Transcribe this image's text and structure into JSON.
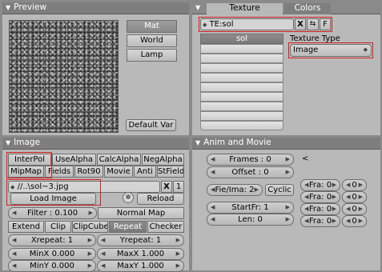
{
  "preview": {
    "title": "Preview",
    "buttons": [
      "Mat",
      "World",
      "Lamp"
    ],
    "default_var": "Default Var"
  },
  "texture": {
    "tabs": [
      "Texture",
      "Colors"
    ],
    "name_field": "TE:sol",
    "x_btn": "X",
    "f_btn": "F",
    "list_header": "sol",
    "type_label": "Texture Type",
    "type_value": "Image"
  },
  "image": {
    "title": "Image",
    "row1": [
      "InterPol",
      "UseAlpha",
      "CalcAlpha",
      "NegAlpha"
    ],
    "row2": [
      "MipMap",
      "Fields",
      "Rot90",
      "Movie",
      "Anti",
      "StField"
    ],
    "path": "//..\\sol~3.jpg",
    "x_btn": "X",
    "num_btn": "1",
    "load": "Load Image",
    "reload": "Reload",
    "filter": "Filter : 0.100",
    "normal_map": "Normal Map",
    "extend_row": [
      "Extend",
      "Clip",
      "ClipCube",
      "Repeat",
      "Checker"
    ],
    "xrepeat": "Xrepeat: 1",
    "yrepeat": "Yrepeat: 1",
    "minx": "MinX 0.000",
    "maxx": "MaxX 1.000",
    "miny": "MinY 0.000",
    "maxy": "MaxY 1.000"
  },
  "anim": {
    "title": "Anim and Movie",
    "frames": "Frames : 0",
    "offset": "Offset : 0",
    "fie_ima": "Fie/Ima: 2",
    "cyclic": "Cyclic",
    "startfr": "StartFr: 1",
    "len": "Len: 0",
    "lt": "<",
    "fra_rows": [
      {
        "fra": "Fra: 0",
        "val": "0"
      },
      {
        "fra": "Fra: 0",
        "val": "0"
      },
      {
        "fra": "Fra: 0",
        "val": "0"
      },
      {
        "fra": "Fra: 0",
        "val": "0"
      }
    ]
  }
}
